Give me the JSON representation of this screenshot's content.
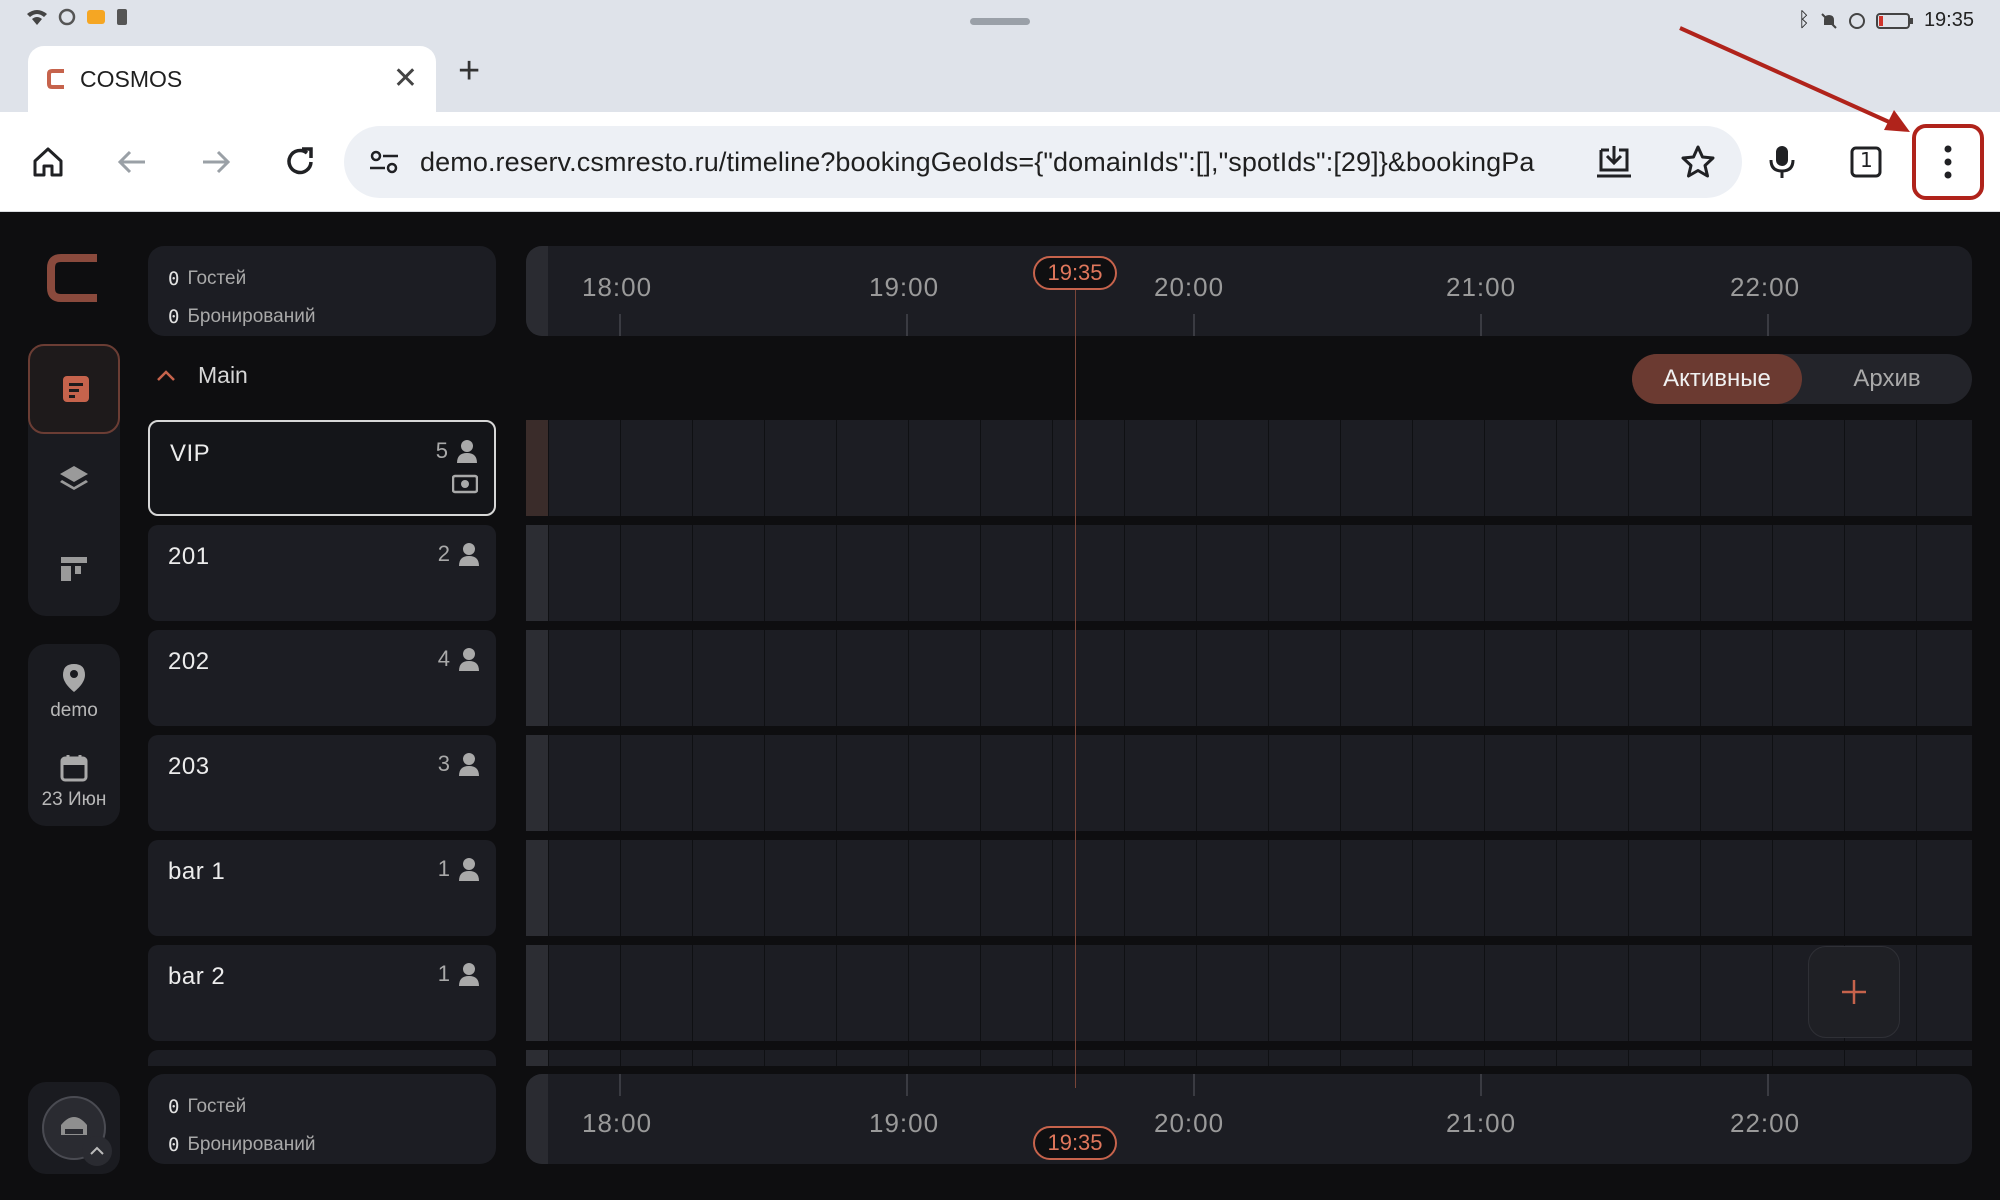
{
  "statusbar": {
    "time": "19:35"
  },
  "tab": {
    "title": "COSMOS",
    "close": "✕",
    "new_tab": "+"
  },
  "toolbar": {
    "url": "demo.reserv.csmresto.ru/timeline?bookingGeoIds={\"domainIds\":[],\"spotIds\":[29]}&bookingPa",
    "tab_count": "1"
  },
  "sidebar": {
    "location_label": "demo",
    "date_label": "23 Июн"
  },
  "summary_top": {
    "guests_count": "0",
    "guests_label": "Гостей",
    "bookings_count": "0",
    "bookings_label": "Бронирований"
  },
  "summary_bottom": {
    "guests_count": "0",
    "guests_label": "Гостей",
    "bookings_count": "0",
    "bookings_label": "Бронирований"
  },
  "group": {
    "name": "Main"
  },
  "tables": [
    {
      "name": "VIP",
      "capacity": "5"
    },
    {
      "name": "201",
      "capacity": "2"
    },
    {
      "name": "202",
      "capacity": "4"
    },
    {
      "name": "203",
      "capacity": "3"
    },
    {
      "name": "bar 1",
      "capacity": "1"
    },
    {
      "name": "bar 2",
      "capacity": "1"
    }
  ],
  "timeline": {
    "hours": [
      "18:00",
      "19:00",
      "20:00",
      "21:00",
      "22:00"
    ],
    "now": "19:35"
  },
  "filter": {
    "active_label": "Активные",
    "archive_label": "Архив"
  },
  "fab": {
    "label": "+"
  },
  "colors": {
    "accent": "#c6634c",
    "panel": "#1c1d23",
    "background": "#0e0e10"
  }
}
